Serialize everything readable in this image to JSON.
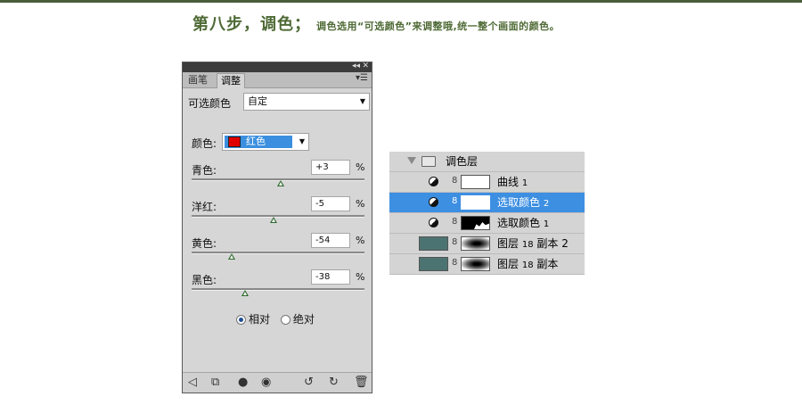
{
  "heading": {
    "main": "第八步，调色；",
    "sub": "调色选用“可选颜色”来调整哦,统一整个画面的颜色。"
  },
  "adjust_panel": {
    "tabs": [
      "画笔",
      "调整"
    ],
    "active_tab": "调整",
    "preset_label": "可选颜色",
    "preset_value": "自定",
    "color_label": "颜色:",
    "color_value": "红色",
    "swatch_color": "#e10000",
    "sliders": [
      {
        "label": "青色:",
        "value": "+3",
        "unit": "%",
        "level": 0.515
      },
      {
        "label": "洋红:",
        "value": "-5",
        "unit": "%",
        "level": 0.475
      },
      {
        "label": "黄色:",
        "value": "-54",
        "unit": "%",
        "level": 0.23
      },
      {
        "label": "黑色:",
        "value": "-38",
        "unit": "%",
        "level": 0.31
      }
    ],
    "mode_options": [
      "相对",
      "绝对"
    ],
    "mode_selected": "相对"
  },
  "layers": {
    "group": "调色层",
    "items": [
      {
        "name": "曲线",
        "num": "1",
        "kind": "adjustment",
        "mask": "white",
        "selected": false
      },
      {
        "name": "选取颜色",
        "num": "2",
        "kind": "adjustment",
        "mask": "white",
        "selected": true
      },
      {
        "name": "选取颜色",
        "num": "1",
        "kind": "adjustment",
        "mask": "black",
        "selected": false
      },
      {
        "name": "图层",
        "num": "18",
        "suffix": "副本 2",
        "kind": "pixel",
        "mask": "blur",
        "selected": false
      },
      {
        "name": "图层",
        "num": "18",
        "suffix": "副本",
        "kind": "pixel",
        "mask": "blur",
        "selected": false
      }
    ]
  },
  "colors": {
    "heading": "#4e6a35",
    "selection": "#3d8fe2",
    "layer_thumb": "#4b7371"
  }
}
